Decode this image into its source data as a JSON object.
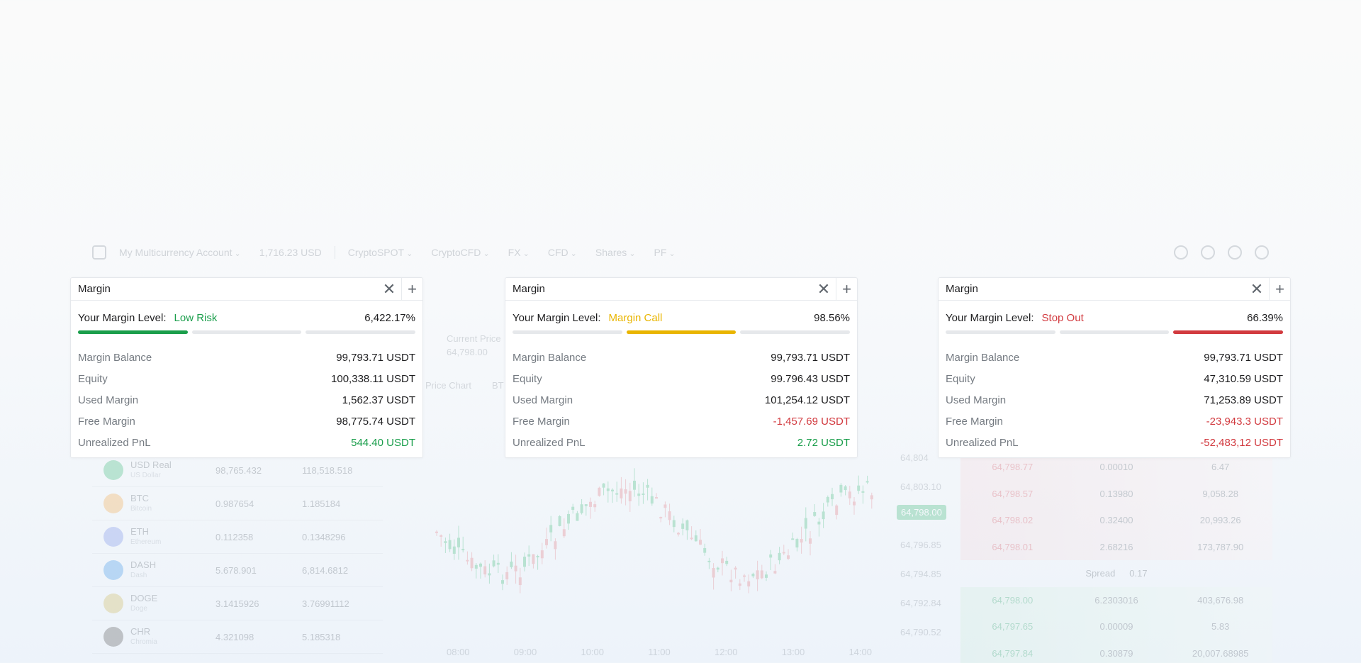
{
  "background": {
    "nav": {
      "account": "My Multicurrency Account",
      "balance": "1,716.23 USD",
      "items": [
        "CryptoSPOT",
        "CryptoCFD",
        "FX",
        "CFD",
        "Shares",
        "PF"
      ]
    },
    "current_price_label": "Current Price",
    "current_price_value": "64,798.00",
    "price_chart_label": "Price Chart",
    "price_chart_symbol": "BT",
    "assets": [
      {
        "symbol": "USD",
        "tag": "Real",
        "name": "US Dollar",
        "v1": "98,765.432",
        "v2": "118,518.518",
        "color": "#2ab36b"
      },
      {
        "symbol": "BTC",
        "tag": "",
        "name": "Bitcoin",
        "v1": "0.987654",
        "v2": "1.185184",
        "color": "#f4a33a"
      },
      {
        "symbol": "ETH",
        "tag": "",
        "name": "Ethereum",
        "v1": "0.112358",
        "v2": "0.1348296",
        "color": "#6c84e8"
      },
      {
        "symbol": "DASH",
        "tag": "",
        "name": "Dash",
        "v1": "5.678.901",
        "v2": "6,814.6812",
        "color": "#2b8ce6"
      },
      {
        "symbol": "DOGE",
        "tag": "",
        "name": "Doge",
        "v1": "3.1415926",
        "v2": "3.76991112",
        "color": "#c9b24a"
      },
      {
        "symbol": "CHR",
        "tag": "",
        "name": "Chromia",
        "v1": "4.321098",
        "v2": "5.185318",
        "color": "#444444"
      }
    ],
    "times": [
      "08:00",
      "09:00",
      "10:00",
      "11:00",
      "12:00",
      "13:00",
      "14:00"
    ],
    "prices": [
      "64,804",
      "64,803.10",
      "",
      "64,796.85",
      "64,794.85",
      "64,792.84",
      "64,790.52"
    ],
    "price_tag": "64,798.00",
    "book": {
      "asks": [
        [
          "64,798.77",
          "0.00010",
          "6.47"
        ],
        [
          "64,798.57",
          "0.13980",
          "9,058.28"
        ],
        [
          "64,798.02",
          "0.32400",
          "20,993.26"
        ],
        [
          "64,798.01",
          "2.68216",
          "173,787.90"
        ]
      ],
      "spread_label": "Spread",
      "spread_value": "0.17",
      "bids": [
        [
          "64,798.00",
          "6.2303016",
          "403,676.98"
        ],
        [
          "64,797.65",
          "0.00009",
          "5.83"
        ],
        [
          "64,797.84",
          "0.30879",
          "20,007.68985"
        ]
      ]
    }
  },
  "cards": [
    {
      "title": "Margin",
      "level_label": "Your Margin Level:",
      "status": "Low Risk",
      "status_color": "#1a9e4b",
      "level_value": "6,422.17%",
      "active_segment": 0,
      "rows": [
        {
          "label": "Margin Balance",
          "value": "99,793.71 USDT",
          "tone": ""
        },
        {
          "label": "Equity",
          "value": "100,338.11 USDT",
          "tone": ""
        },
        {
          "label": "Used Margin",
          "value": "1,562.37 USDT",
          "tone": ""
        },
        {
          "label": "Free Margin",
          "value": "98,775.74 USDT",
          "tone": ""
        },
        {
          "label": "Unrealized PnL",
          "value": "544.40 USDT",
          "tone": "green"
        }
      ]
    },
    {
      "title": "Margin",
      "level_label": "Your Margin Level:",
      "status": "Margin Call",
      "status_color": "#e9b500",
      "level_value": "98.56%",
      "active_segment": 1,
      "rows": [
        {
          "label": "Margin Balance",
          "value": "99,793.71 USDT",
          "tone": ""
        },
        {
          "label": "Equity",
          "value": "99.796.43 USDT",
          "tone": ""
        },
        {
          "label": "Used Margin",
          "value": "101,254.12 USDT",
          "tone": ""
        },
        {
          "label": "Free Margin",
          "value": "-1,457.69 USDT",
          "tone": "red"
        },
        {
          "label": "Unrealized PnL",
          "value": "2.72 USDT",
          "tone": "green"
        }
      ]
    },
    {
      "title": "Margin",
      "level_label": "Your Margin Level:",
      "status": "Stop Out",
      "status_color": "#d23a3f",
      "level_value": "66.39%",
      "active_segment": 2,
      "rows": [
        {
          "label": "Margin Balance",
          "value": "99,793.71 USDT",
          "tone": ""
        },
        {
          "label": "Equity",
          "value": "47,310.59 USDT",
          "tone": ""
        },
        {
          "label": "Used Margin",
          "value": "71,253.89 USDT",
          "tone": ""
        },
        {
          "label": "Free Margin",
          "value": "-23,943.3 USDT",
          "tone": "red"
        },
        {
          "label": "Unrealized PnL",
          "value": "-52,483,12 USDT",
          "tone": "red"
        }
      ]
    }
  ],
  "icons": {
    "close": "close-icon",
    "add": "plus-icon",
    "home": "home-icon"
  }
}
